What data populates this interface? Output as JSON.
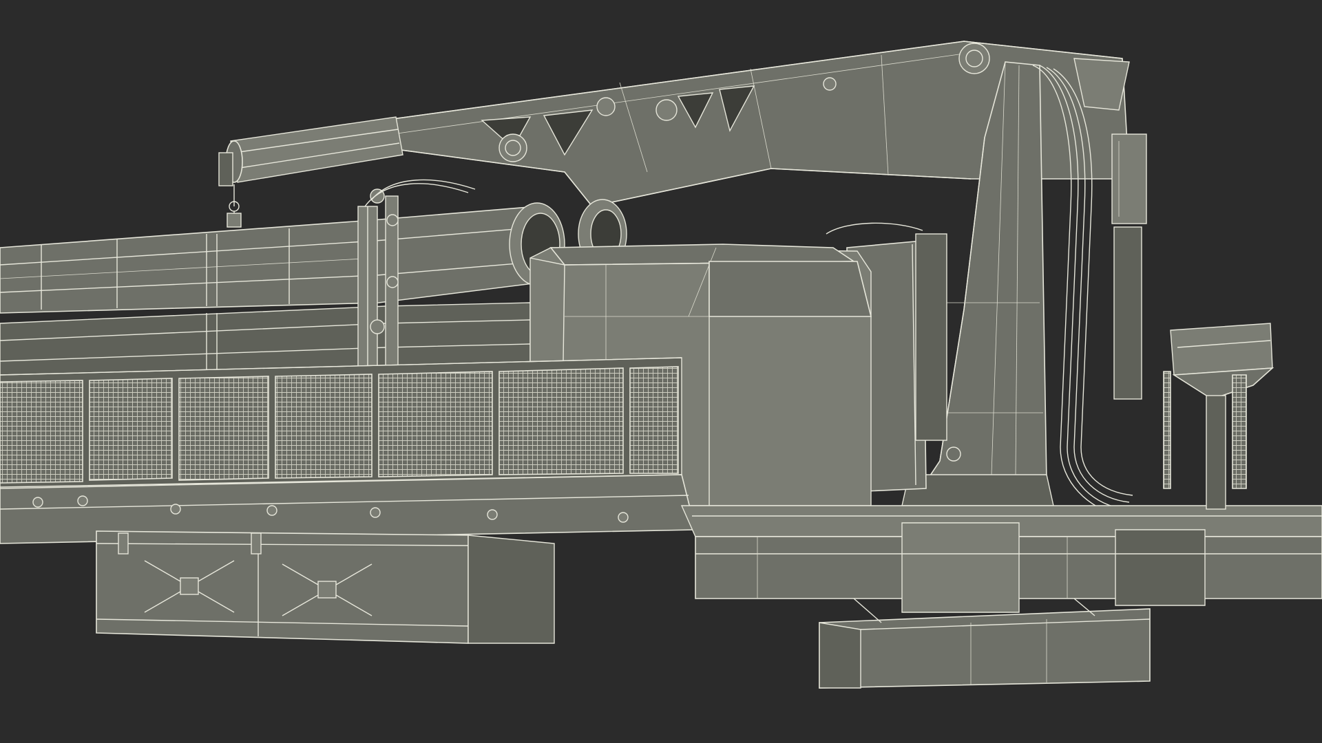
{
  "scene": {
    "background": "#2b2b2b",
    "model_color": "#6e7068",
    "wire_color": "#e8e8dc",
    "view": "wireframe-on-shaded"
  }
}
